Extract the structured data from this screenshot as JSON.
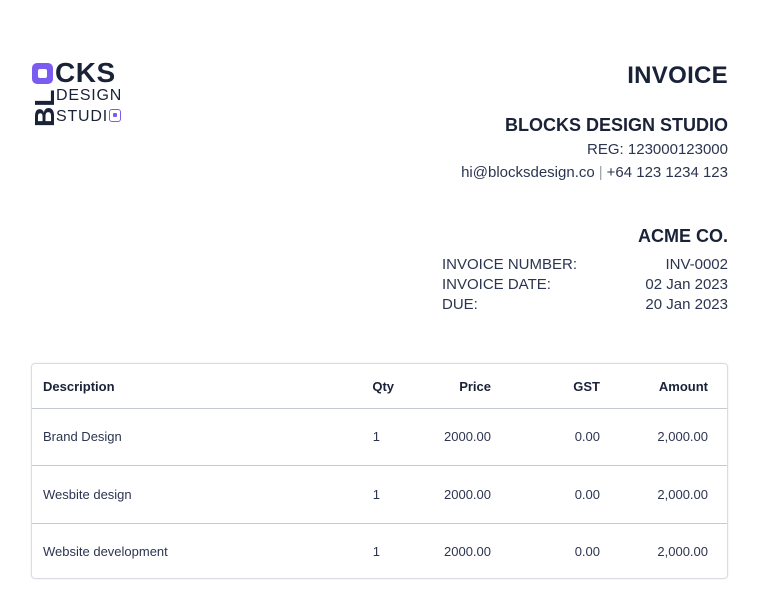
{
  "logo": {
    "vertical": "BL",
    "top": "CKS",
    "line2": "DESIGN",
    "line3": "STUDI"
  },
  "invoice": {
    "title": "INVOICE",
    "company": "BLOCKS DESIGN STUDIO",
    "reg": "REG: 123000123000",
    "email": "hi@blocksdesign.co",
    "separator": "|",
    "phone": "+64 123 1234 123",
    "client": "ACME CO.",
    "meta": [
      {
        "label": "INVOICE NUMBER:",
        "value": "INV-0002"
      },
      {
        "label": "INVOICE DATE:",
        "value": "02 Jan 2023"
      },
      {
        "label": "DUE:",
        "value": "20 Jan 2023"
      }
    ]
  },
  "table": {
    "headers": {
      "description": "Description",
      "qty": "Qty",
      "price": "Price",
      "gst": "GST",
      "amount": "Amount"
    },
    "rows": [
      {
        "description": "Brand Design",
        "qty": "1",
        "price": "2000.00",
        "gst": "0.00",
        "amount": "2,000.00"
      },
      {
        "description": "Wesbite design",
        "qty": "1",
        "price": "2000.00",
        "gst": "0.00",
        "amount": "2,000.00"
      },
      {
        "description": "Website development",
        "qty": "1",
        "price": "2000.00",
        "gst": "0.00",
        "amount": "2,000.00"
      }
    ]
  },
  "colors": {
    "ink": "#1a2238",
    "accent": "#7b5cf0",
    "border": "#c5c9d1"
  }
}
